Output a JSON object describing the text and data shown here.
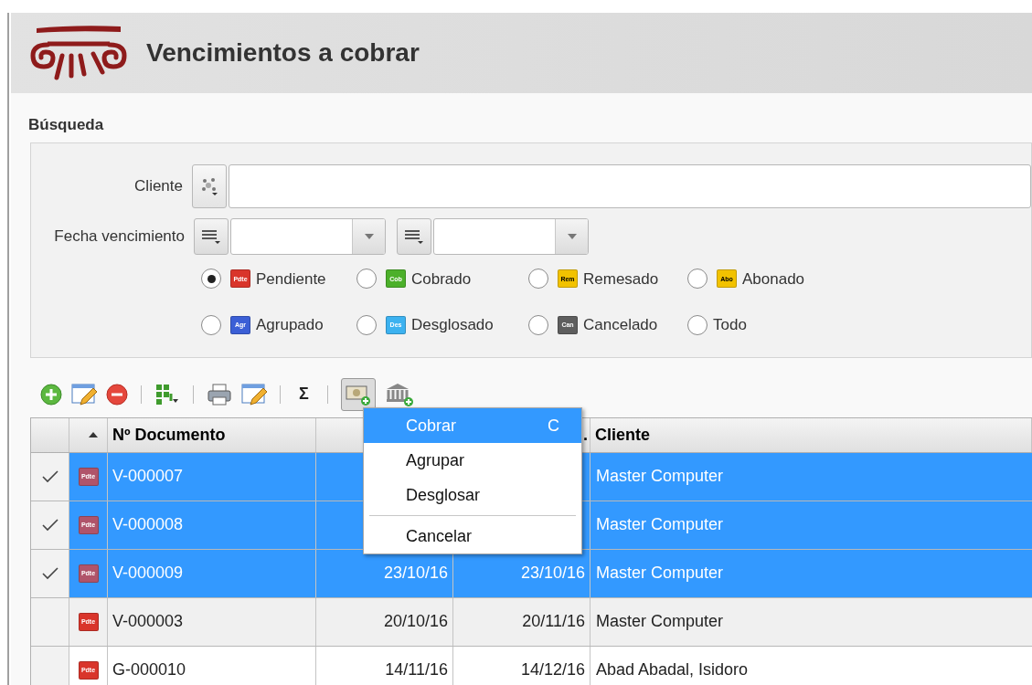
{
  "header": {
    "title": "Vencimientos a cobrar"
  },
  "search": {
    "title": "Búsqueda",
    "cliente": {
      "label": "Cliente"
    },
    "fecha": {
      "label": "Fecha vencimiento"
    },
    "estados": [
      {
        "label": "Pendiente",
        "badge": "Pdte",
        "color": "#d9352b",
        "selected": true
      },
      {
        "label": "Cobrado",
        "badge": "Cob",
        "color": "#4cb02a",
        "selected": false
      },
      {
        "label": "Remesado",
        "badge": "Rem",
        "color": "#f2c200",
        "selected": false
      },
      {
        "label": "Abonado",
        "badge": "Abo",
        "color": "#f2c200",
        "selected": false
      },
      {
        "label": "Agrupado",
        "badge": "Agr",
        "color": "#3b5fd6",
        "selected": false
      },
      {
        "label": "Desglosado",
        "badge": "Des",
        "color": "#3cb2f0",
        "selected": false
      },
      {
        "label": "Cancelado",
        "badge": "Can",
        "color": "#5e5e5e",
        "selected": false
      },
      {
        "label": "Todo",
        "selected": false
      }
    ]
  },
  "toolbar": [
    {
      "kind": "add"
    },
    {
      "kind": "edit"
    },
    {
      "kind": "delete"
    },
    {
      "kind": "sep"
    },
    {
      "kind": "grid"
    },
    {
      "kind": "sep"
    },
    {
      "kind": "print"
    },
    {
      "kind": "edit"
    },
    {
      "kind": "sep"
    },
    {
      "kind": "text",
      "label": "Σ"
    },
    {
      "kind": "sep"
    },
    {
      "kind": "money",
      "pressed": true
    },
    {
      "kind": "bank"
    }
  ],
  "table": {
    "columns": [
      {},
      {
        "sort_ascending": true
      },
      {
        "label": "Nº Documento"
      },
      {},
      {
        "label": "."
      },
      {
        "label": "Cliente"
      }
    ],
    "rows": [
      {
        "checked": true,
        "selected": true,
        "badge": "Pdte",
        "color": "#b0546a",
        "documento": "V-000007",
        "cliente": "Master Computer"
      },
      {
        "checked": true,
        "selected": true,
        "badge": "Pdte",
        "color": "#b0546a",
        "documento": "V-000008",
        "cliente": "Master Computer"
      },
      {
        "checked": true,
        "selected": true,
        "badge": "Pdte",
        "color": "#b0546a",
        "documento": "V-000009",
        "fecha_1": "23/10/16",
        "fecha_2": "23/10/16",
        "cliente": "Master Computer"
      },
      {
        "checked": false,
        "selected": false,
        "badge": "Pdte",
        "color": "#d9352b",
        "documento": "V-000003",
        "fecha_1": "20/10/16",
        "fecha_2": "20/11/16",
        "cliente": "Master Computer"
      },
      {
        "checked": false,
        "selected": false,
        "badge": "Pdte",
        "color": "#d9352b",
        "documento": "G-000010",
        "fecha_1": "14/11/16",
        "fecha_2": "14/12/16",
        "cliente": "Abad Abadal, Isidoro"
      }
    ]
  },
  "menu": {
    "items": [
      {
        "kind": "item",
        "label": "Cobrar",
        "shortcut": "C",
        "selected": true
      },
      {
        "kind": "item",
        "label": "Agrupar",
        "selected": false
      },
      {
        "kind": "item",
        "label": "Desglosar",
        "selected": false
      },
      {
        "kind": "sep"
      },
      {
        "kind": "item",
        "label": "Cancelar",
        "selected": false
      }
    ]
  }
}
